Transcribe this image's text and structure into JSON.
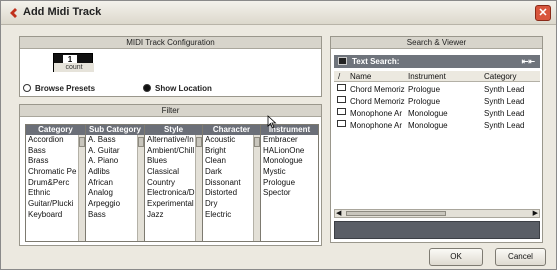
{
  "window": {
    "title": "Add Midi Track",
    "close_glyph": "✕"
  },
  "config": {
    "header": "MIDI Track Configuration",
    "count_value": "1",
    "count_label": "count"
  },
  "options": {
    "browse_presets": "Browse Presets",
    "show_location": "Show Location",
    "browse_selected": false,
    "show_selected": true
  },
  "filter": {
    "header": "Filter",
    "columns": [
      {
        "title": "Category",
        "items": [
          "Accordion",
          "Bass",
          "Brass",
          "Chromatic Pe",
          "Drum&Perc",
          "Ethnic",
          "Guitar/Plucki",
          "Keyboard"
        ]
      },
      {
        "title": "Sub Category",
        "items": [
          "A. Bass",
          "A. Guitar",
          "A. Piano",
          "Adlibs",
          "African",
          "Analog",
          "Arpeggio",
          "Bass"
        ]
      },
      {
        "title": "Style",
        "items": [
          "Alternative/In",
          "Ambient/Chill",
          "Blues",
          "Classical",
          "Country",
          "Electronica/D",
          "Experimental",
          "Jazz"
        ]
      },
      {
        "title": "Character",
        "items": [
          "Acoustic",
          "Bright",
          "Clean",
          "Dark",
          "Dissonant",
          "Distorted",
          "Dry",
          "Electric"
        ]
      },
      {
        "title": "Instrument",
        "items": [
          "Embracer",
          "HALionOne",
          "Monologue",
          "Mystic",
          "Prologue",
          "Spector"
        ]
      }
    ]
  },
  "viewer": {
    "header": "Search & Viewer",
    "search_label": "Text Search:",
    "search_shortcut": "⇤⇤",
    "columns": {
      "mark": "/",
      "name": "Name",
      "instrument": "Instrument",
      "category": "Category"
    },
    "results": [
      {
        "name": "Chord Memoriz",
        "instrument": "Prologue",
        "category": "Synth Lead"
      },
      {
        "name": "Chord Memoriz",
        "instrument": "Prologue",
        "category": "Synth Lead"
      },
      {
        "name": "Monophone Ar",
        "instrument": "Monologue",
        "category": "Synth Lead"
      },
      {
        "name": "Monophone Ar",
        "instrument": "Monologue",
        "category": "Synth Lead"
      }
    ],
    "scroll_left": "◀",
    "scroll_right": "▶"
  },
  "buttons": {
    "ok": "OK",
    "cancel": "Cancel"
  },
  "colors": {
    "accent_header": "#6b6f78",
    "dialog_bg": "#ece9e0",
    "close": "#d8553c"
  },
  "icons": {
    "title": "cubase-logo-icon",
    "search": "search-bank-icon",
    "result": "preset-file-icon"
  }
}
